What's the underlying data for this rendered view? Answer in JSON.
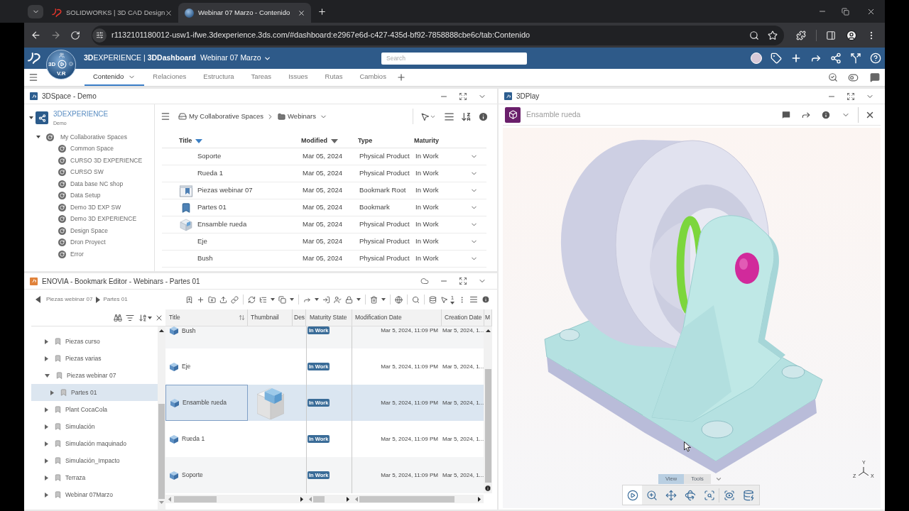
{
  "browser": {
    "tabs": [
      {
        "title": "SOLIDWORKS | 3D CAD Design",
        "selected": false
      },
      {
        "title": "Webinar 07 Marzo - Contenido",
        "selected": true
      }
    ],
    "url": "r1132101180012-usw1-ifwe.3dexperience.3ds.com/#dashboard:e2967e6d-c427-435d-bf92-7858888cbe6c/tab:Contenido"
  },
  "app_header": {
    "title": "**3D**EXPERIENCE | **3DDashboard**",
    "dashboard": "Webinar 07 Marzo",
    "compass": {
      "left": "3D",
      "bottom": "V.R"
    },
    "search": {
      "placeholder": "Search"
    }
  },
  "dashboard_tabs": [
    {
      "label": "Contenido",
      "selected": true
    },
    {
      "label": "Relaciones",
      "selected": false
    },
    {
      "label": "Estructura",
      "selected": false
    },
    {
      "label": "Tareas",
      "selected": false
    },
    {
      "label": "Issues",
      "selected": false
    },
    {
      "label": "Rutas",
      "selected": false
    },
    {
      "label": "Cambios",
      "selected": false
    }
  ],
  "space_panel": {
    "title": "3DSpace - Demo",
    "tree": {
      "label": "3DEXPERIENCE",
      "sublabel": "Demo",
      "expanded": true,
      "children": [
        {
          "label": "My Collaborative Spaces",
          "expanded": true,
          "children": [
            {
              "label": "Common Space"
            },
            {
              "label": "CURSO 3D EXPERIENCE"
            },
            {
              "label": "CURSO SW"
            },
            {
              "label": "Data base NC shop"
            },
            {
              "label": "Data Setup"
            },
            {
              "label": "Demo 3D EXP SW"
            },
            {
              "label": "Demo 3D EXPERIENCE"
            },
            {
              "label": "Design Space"
            },
            {
              "label": "Dron Proyect"
            },
            {
              "label": "Error"
            }
          ]
        }
      ]
    },
    "breadcrumb": [
      "My Collaborative Spaces",
      "Webinars"
    ],
    "table": {
      "columns": [
        {
          "label": "Title",
          "sort_indicator": true,
          "sort_active": true
        },
        {
          "label": "Modified",
          "sort_indicator": true,
          "sort_active": false
        },
        {
          "label": "Type",
          "sort_indicator": false,
          "sort_active": false
        },
        {
          "label": "Maturity",
          "sort_indicator": false,
          "sort_active": false
        }
      ],
      "rows": [
        {
          "kind": "plain",
          "title": "Soporte",
          "modified": "Mar 05, 2024",
          "type": "Physical Product",
          "maturity": "In Work"
        },
        {
          "kind": "plain",
          "title": "Rueda 1",
          "modified": "Mar 05, 2024",
          "type": "Physical Product",
          "maturity": "In Work"
        },
        {
          "kind": "root",
          "title": "Piezas webinar 07",
          "modified": "Mar 05, 2024",
          "type": "Bookmark Root",
          "maturity": "In Work"
        },
        {
          "kind": "bookmark",
          "title": "Partes 01",
          "modified": "Mar 05, 2024",
          "type": "Bookmark",
          "maturity": "In Work"
        },
        {
          "kind": "assembly",
          "title": "Ensamble rueda",
          "modified": "Mar 05, 2024",
          "type": "Physical Product",
          "maturity": "In Work"
        },
        {
          "kind": "plain",
          "title": "Eje",
          "modified": "Mar 05, 2024",
          "type": "Physical Product",
          "maturity": "In Work"
        },
        {
          "kind": "plain",
          "title": "Bush",
          "modified": "Mar 05, 2024",
          "type": "Physical Product",
          "maturity": "In Work"
        }
      ]
    }
  },
  "enovia_panel": {
    "title": "ENOVIA - Bookmark Editor - Webinars - Partes 01",
    "breadcrumb": [
      "Piezas webinar 07",
      "Partes 01"
    ],
    "selection_count": "1",
    "tree": [
      {
        "label": "Piezas curso",
        "expanded": false,
        "selected": false
      },
      {
        "label": "Piezas varias",
        "expanded": false,
        "selected": false
      },
      {
        "label": "Piezas webinar 07",
        "expanded": true,
        "selected": false,
        "children": [
          {
            "label": "Partes 01",
            "expanded": false,
            "selected": true
          }
        ]
      },
      {
        "label": "Plant CocaCola",
        "expanded": false,
        "selected": false
      },
      {
        "label": "Simulación",
        "expanded": false,
        "selected": false
      },
      {
        "label": "Simulación maquinado",
        "expanded": false,
        "selected": false
      },
      {
        "label": "Simulación_Impacto",
        "expanded": false,
        "selected": false
      },
      {
        "label": "Terraza",
        "expanded": false,
        "selected": false
      },
      {
        "label": "Webinar 07Marzo",
        "expanded": false,
        "selected": false
      }
    ],
    "grid": {
      "columns": [
        {
          "label": "Title",
          "sort_icon": true
        },
        {
          "label": "Thumbnail",
          "sort_icon": false
        },
        {
          "label": "Des",
          "sort_icon": false
        },
        {
          "label": "Maturity State",
          "sort_icon": false
        },
        {
          "label": "Modification Date",
          "sort_icon": false
        },
        {
          "label": "Creation Date",
          "sort_icon": false
        },
        {
          "label": "M",
          "sort_icon": false
        }
      ],
      "rows": [
        {
          "title": "Bush",
          "maturity": "In Work",
          "modified": "Mar 5, 2024, 11:09 PM",
          "created": "Mar 5, 2024, 1...",
          "selected": false,
          "thumbnail": false
        },
        {
          "title": "Eje",
          "maturity": "In Work",
          "modified": "Mar 5, 2024, 11:09 PM",
          "created": "Mar 5, 2024, 1...",
          "selected": false,
          "thumbnail": false
        },
        {
          "title": "Ensamble rueda",
          "maturity": "In Work",
          "modified": "Mar 5, 2024, 11:09 PM",
          "created": "Mar 5, 2024, 1...",
          "selected": true,
          "thumbnail": true
        },
        {
          "title": "Rueda 1",
          "maturity": "In Work",
          "modified": "Mar 5, 2024, 11:09 PM",
          "created": "Mar 5, 2024, 1...",
          "selected": false,
          "thumbnail": false
        },
        {
          "title": "Soporte",
          "maturity": "In Work",
          "modified": "Mar 5, 2024, 11:09 PM",
          "created": "Mar 5, 2024, 1...",
          "selected": false,
          "thumbnail": false
        }
      ]
    }
  },
  "play_panel": {
    "title": "3DPlay",
    "object": "Ensamble rueda",
    "viewer_tabs": [
      {
        "label": "View",
        "selected": true
      },
      {
        "label": "Tools",
        "selected": false
      }
    ],
    "tools": [
      {
        "selected": true
      },
      {
        "selected": false
      },
      {
        "selected": false
      },
      {
        "selected": false
      },
      {
        "selected": false
      },
      {
        "selected": false
      },
      {
        "selected": false
      }
    ],
    "axes": {
      "y": "Y",
      "z": "Z",
      "x": "X"
    }
  }
}
